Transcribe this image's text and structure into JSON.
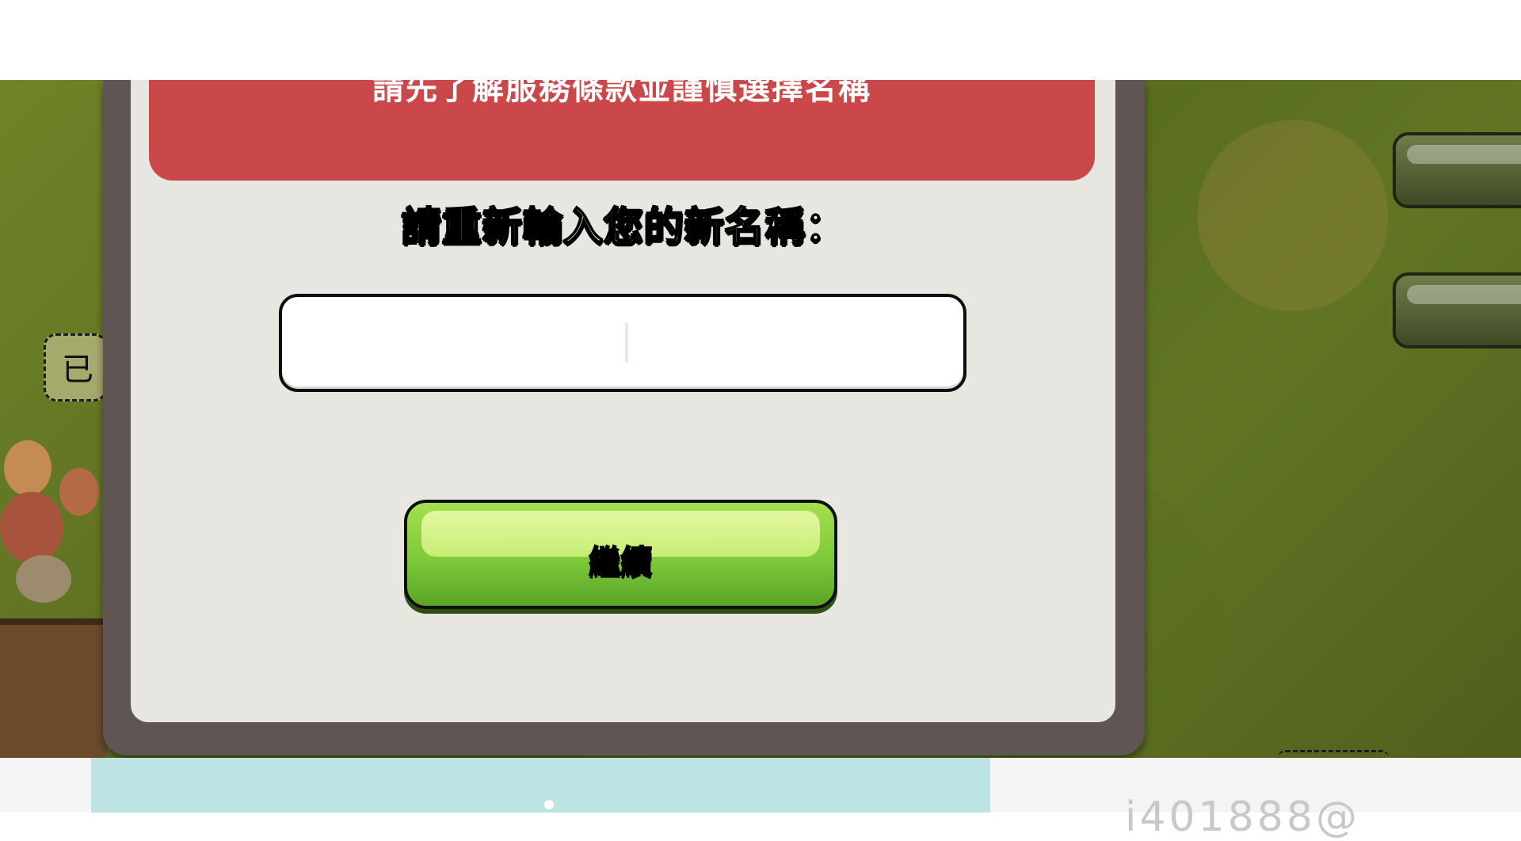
{
  "error_banner": {
    "text": "請先了解服務條款並謹慎選擇名稱"
  },
  "prompt": {
    "label": "請重新輸入您的新名稱："
  },
  "name_input": {
    "value": "",
    "placeholder": ""
  },
  "continue_button": {
    "label": "繼續"
  },
  "left_tag": {
    "text": "已"
  },
  "bottom_right": {
    "text": "i401888@"
  },
  "colors": {
    "banner": "#ca484a",
    "button_green": "#7ec93a",
    "dialog_bg": "#e7e6e1",
    "frame": "#5f5653"
  }
}
